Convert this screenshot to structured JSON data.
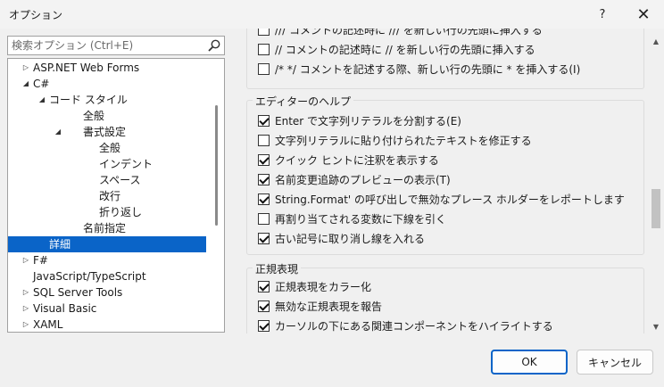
{
  "window": {
    "title": "オプション",
    "help_label": "?",
    "close_label": "✕"
  },
  "search": {
    "placeholder": "検索オプション (Ctrl+E)"
  },
  "tree": {
    "items": [
      {
        "label": "ASP.NET Web Forms",
        "arrow": "▷",
        "level": 1
      },
      {
        "label": "C#",
        "arrow": "◢",
        "level": 1
      },
      {
        "label": "コード スタイル",
        "arrow": "◢",
        "level": 2
      },
      {
        "label": "全般",
        "arrow": "",
        "level": 3
      },
      {
        "label": "書式設定",
        "arrow": "◢",
        "level": 3
      },
      {
        "label": "全般",
        "arrow": "",
        "level": 4
      },
      {
        "label": "インデント",
        "arrow": "",
        "level": 4
      },
      {
        "label": "スペース",
        "arrow": "",
        "level": 4
      },
      {
        "label": "改行",
        "arrow": "",
        "level": 4
      },
      {
        "label": "折り返し",
        "arrow": "",
        "level": 4
      },
      {
        "label": "名前指定",
        "arrow": "",
        "level": 3
      },
      {
        "label": "詳細",
        "arrow": "",
        "level": 2,
        "selected": true
      },
      {
        "label": "F#",
        "arrow": "▷",
        "level": 1
      },
      {
        "label": "JavaScript/TypeScript",
        "arrow": "",
        "level": 1
      },
      {
        "label": "SQL Server Tools",
        "arrow": "▷",
        "level": 1
      },
      {
        "label": "Visual Basic",
        "arrow": "▷",
        "level": 1
      },
      {
        "label": "XAML",
        "arrow": "▷",
        "level": 1
      }
    ]
  },
  "top_group": {
    "items": [
      {
        "label": "/// コメントの記述時に /// を新しい行の先頭に挿入する",
        "checked": false
      },
      {
        "label": "// コメントの記述時に // を新しい行の先頭に挿入する",
        "checked": false
      },
      {
        "label": "/* */ コメントを記述する際、新しい行の先頭に * を挿入する(I)",
        "checked": false
      }
    ]
  },
  "editor_help": {
    "title": "エディターのヘルプ",
    "items": [
      {
        "label": "Enter で文字列リテラルを分割する(E)",
        "checked": true
      },
      {
        "label": "文字列リテラルに貼り付けられたテキストを修正する",
        "checked": false
      },
      {
        "label": "クイック ヒントに注釈を表示する",
        "checked": true
      },
      {
        "label": "名前変更追跡のプレビューの表示(T)",
        "checked": true
      },
      {
        "label": "String.Format' の呼び出しで無効なプレース ホルダーをレポートします",
        "checked": true
      },
      {
        "label": "再割り当てされる変数に下線を引く",
        "checked": false
      },
      {
        "label": "古い記号に取り消し線を入れる",
        "checked": true
      }
    ]
  },
  "regex": {
    "title": "正規表現",
    "items": [
      {
        "label": "正規表現をカラー化",
        "checked": true
      },
      {
        "label": "無効な正規表現を報告",
        "checked": true
      },
      {
        "label": "カーソルの下にある関連コンポーネントをハイライトする",
        "checked": true
      }
    ]
  },
  "buttons": {
    "ok": "OK",
    "cancel": "キャンセル"
  }
}
